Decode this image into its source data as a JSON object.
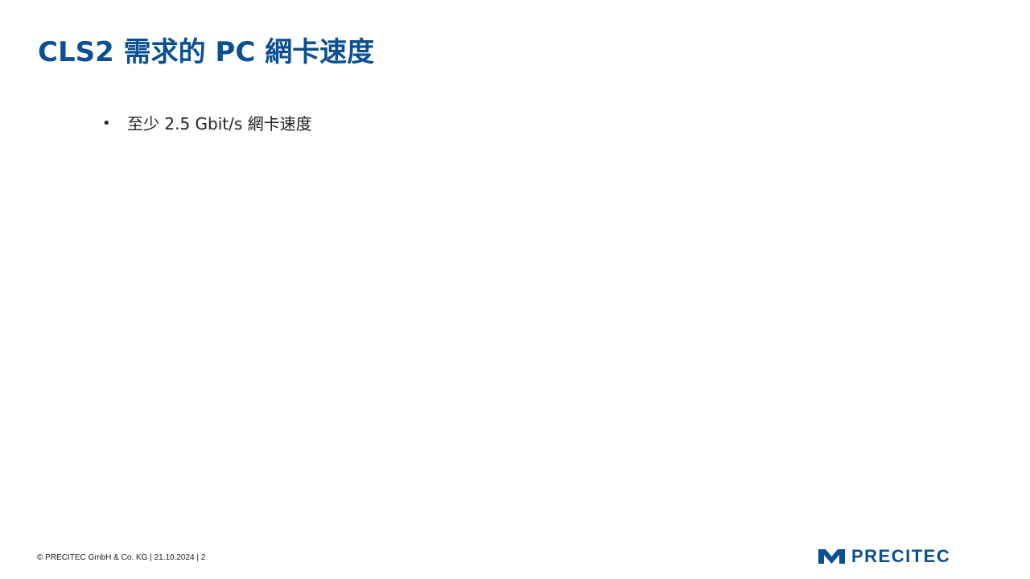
{
  "slide": {
    "title": "CLS2 需求的 PC 網卡速度",
    "bullets": [
      {
        "bullet": "•",
        "text": "至少 2.5 Gbit/s 網卡速度"
      }
    ],
    "footer": "© PRECITEC GmbH & Co. KG | 21.10.2024 | 2",
    "logo": {
      "text": "PRECITEC"
    }
  },
  "colors": {
    "brand_blue": "#0b4f93",
    "body_text": "#222222",
    "background": "#ffffff"
  }
}
